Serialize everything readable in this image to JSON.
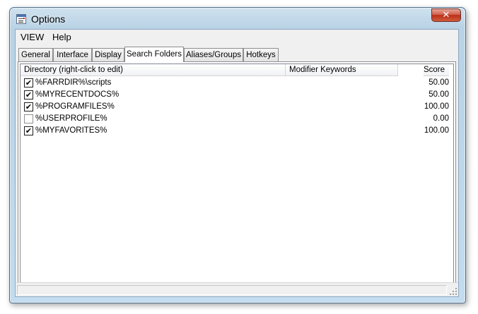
{
  "window": {
    "title": "Options",
    "close_label": "✕"
  },
  "menu": [
    "VIEW",
    "Help"
  ],
  "tabs": [
    {
      "label": "General",
      "active": false
    },
    {
      "label": "Interface",
      "active": false
    },
    {
      "label": "Display",
      "active": false
    },
    {
      "label": "Search Folders",
      "active": true
    },
    {
      "label": "Aliases/Groups",
      "active": false
    },
    {
      "label": "Hotkeys",
      "active": false
    }
  ],
  "table": {
    "columns": [
      "Directory (right-click to edit)",
      "Modifier Keywords",
      "Score"
    ],
    "rows": [
      {
        "checked": true,
        "directory": "%FARRDIR%\\scripts",
        "keywords": "",
        "score": "50.00"
      },
      {
        "checked": true,
        "directory": "%MYRECENTDOCS%",
        "keywords": "",
        "score": "50.00"
      },
      {
        "checked": true,
        "directory": "%PROGRAMFILES%",
        "keywords": "",
        "score": "100.00"
      },
      {
        "checked": false,
        "directory": "%USERPROFILE%",
        "keywords": "",
        "score": "0.00"
      },
      {
        "checked": true,
        "directory": "%MYFAVORITES%",
        "keywords": "",
        "score": "100.00"
      }
    ]
  },
  "icons": {
    "app": "options-app-icon",
    "close": "close-icon",
    "check": "✔",
    "grip": "resize-grip-icon"
  }
}
